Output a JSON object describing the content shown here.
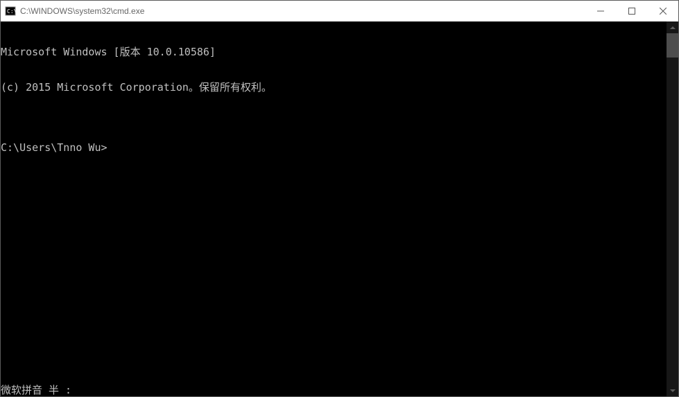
{
  "window": {
    "title": "C:\\WINDOWS\\system32\\cmd.exe"
  },
  "terminal": {
    "lines": [
      "Microsoft Windows [版本 10.0.10586]",
      "(c) 2015 Microsoft Corporation。保留所有权利。",
      "",
      "C:\\Users\\Tnno Wu>"
    ],
    "ime_status": "微软拼音 半 :"
  }
}
